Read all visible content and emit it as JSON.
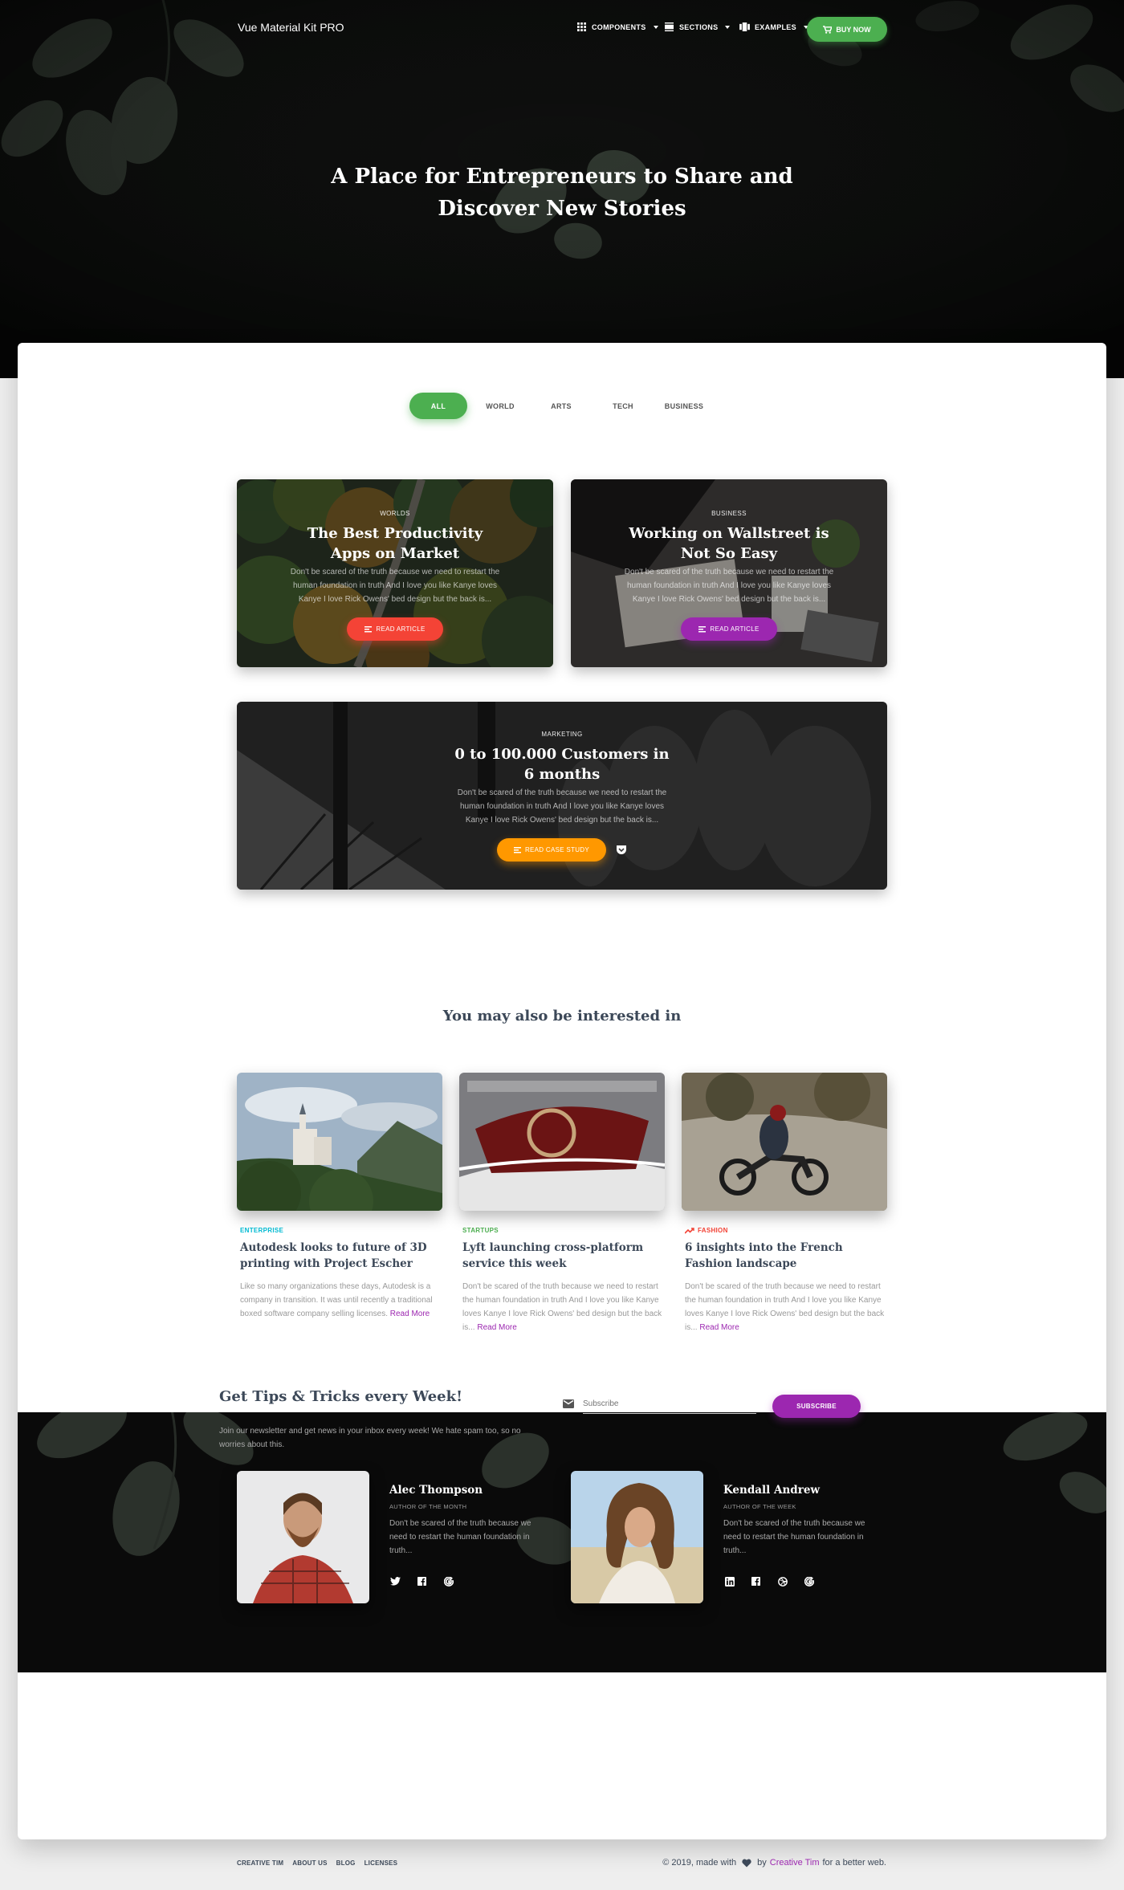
{
  "nav": {
    "brand": "Vue Material Kit PRO",
    "items": [
      {
        "label": "COMPONENTS",
        "icon": "apps-grid-icon"
      },
      {
        "label": "SECTIONS",
        "icon": "view-day-icon"
      },
      {
        "label": "EXAMPLES",
        "icon": "view-carousel-icon"
      }
    ],
    "buy_label": "BUY NOW",
    "buy_icon": "shopping-cart-icon"
  },
  "hero": {
    "title": "A Place for Entrepreneurs to Share and Discover New Stories"
  },
  "filters": {
    "tabs": [
      "ALL",
      "WORLD",
      "ARTS",
      "TECH",
      "BUSINESS"
    ],
    "active": "ALL"
  },
  "stories": [
    {
      "category": "WORLDS",
      "title": "The Best Productivity Apps on Market",
      "description": "Don't be scared of the truth because we need to restart the human foundation in truth And I love you like Kanye loves Kanye I love Rick Owens' bed design but the back is...",
      "button": "READ ARTICLE",
      "button_color": "#f44336"
    },
    {
      "category": "BUSINESS",
      "title": "Working on Wallstreet is Not So Easy",
      "description": "Don't be scared of the truth because we need to restart the human foundation in truth And I love you like Kanye loves Kanye I love Rick Owens' bed design but the back is...",
      "button": "READ ARTICLE",
      "button_color": "#9c27b0"
    },
    {
      "category": "MARKETING",
      "title": "0 to 100.000 Customers in 6 months",
      "description": "Don't be scared of the truth because we need to restart the human foundation in truth And I love you like Kanye loves Kanye I love Rick Owens' bed design but the back is...",
      "button": "READ CASE STUDY",
      "button_color": "#ff9800",
      "extra_icon": "pocket-icon"
    }
  ],
  "interested": {
    "title": "You may also be interested in",
    "posts": [
      {
        "category": "ENTERPRISE",
        "category_color": "#00bcd4",
        "title": "Autodesk looks to future of 3D printing with Project Escher",
        "description": "Like so many organizations these days, Autodesk is a company in transition. It was until recently a traditional boxed software company selling licenses.",
        "more": "Read More"
      },
      {
        "category": "STARTUPS",
        "category_color": "#4caf50",
        "title": "Lyft launching cross-platform service this week",
        "description": "Don't be scared of the truth because we need to restart the human foundation in truth And I love you like Kanye loves Kanye I love Rick Owens' bed design but the back is...",
        "more": "Read More"
      },
      {
        "category": "FASHION",
        "category_color": "#f44336",
        "category_icon": "trending-up-icon",
        "title": "6 insights into the French Fashion landscape",
        "description": "Don't be scared of the truth because we need to restart the human foundation in truth And I love you like Kanye loves Kanye I love Rick Owens' bed design but the back is...",
        "more": "Read More"
      }
    ]
  },
  "team": [
    {
      "name": "Alec Thompson",
      "role": "AUTHOR OF THE MONTH",
      "bio": "Don't be scared of the truth because we need to restart the human foundation in truth...",
      "socials": [
        "twitter-icon",
        "facebook-icon",
        "google-icon"
      ]
    },
    {
      "name": "Kendall Andrew",
      "role": "AUTHOR OF THE WEEK",
      "bio": "Don't be scared of the truth because we need to restart the human foundation in truth...",
      "socials": [
        "linkedin-icon",
        "facebook-icon",
        "dribbble-icon",
        "google-icon"
      ]
    }
  ],
  "newsletter": {
    "title": "Get Tips & Tricks every Week!",
    "description": "Join our newsletter and get news in your inbox every week! We hate spam too, so no worries about this.",
    "placeholder": "Subscribe",
    "button": "SUBSCRIBE"
  },
  "footer": {
    "links": [
      "CREATIVE TIM",
      "ABOUT US",
      "BLOG",
      "LICENSES"
    ],
    "copy_prefix": "© 2019, made with",
    "copy_by": "by",
    "copy_link": "Creative Tim",
    "copy_suffix": "for a better web."
  },
  "colors": {
    "primary": "#9c27b0",
    "success": "#4caf50",
    "danger": "#f44336",
    "warning": "#ff9800",
    "info": "#00bcd4"
  }
}
